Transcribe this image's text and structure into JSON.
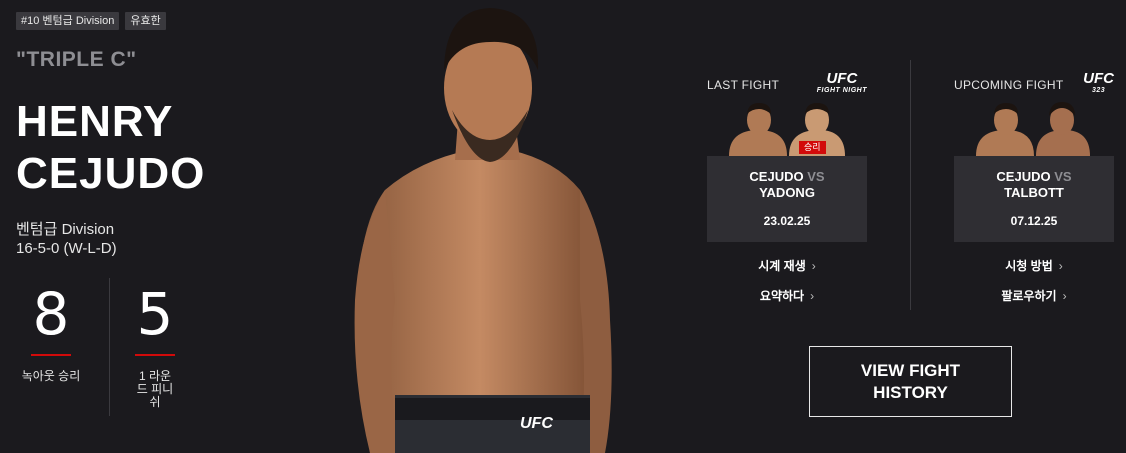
{
  "tags": [
    "#10 벤텀급 Division",
    "유효한"
  ],
  "fighter": {
    "nickname": "\"TRIPLE C\"",
    "name_line1": "HENRY",
    "name_line2": "CEJUDO",
    "division": "벤텀급 Division",
    "record": "16-5-0 (W-L-D)"
  },
  "stats": [
    {
      "value": "8",
      "label": "녹아웃 승리"
    },
    {
      "value": "5",
      "label_lines": [
        "1 라운",
        "드 피니",
        "쉬"
      ]
    }
  ],
  "last_fight": {
    "label": "LAST FIGHT",
    "logo_main": "UFC",
    "logo_sub": "FIGHT NIGHT",
    "win_badge": "승리",
    "fighter_a": "CEJUDO",
    "vs": "VS",
    "fighter_b": "YADONG",
    "date": "23.02.25",
    "links": [
      "시계 재생",
      "요약하다"
    ]
  },
  "upcoming_fight": {
    "label": "UPCOMING FIGHT",
    "logo_main": "UFC",
    "logo_sub": "323",
    "fighter_a": "CEJUDO",
    "vs": "VS",
    "fighter_b": "TALBOTT",
    "date": "07.12.25",
    "links": [
      "시청 방법",
      "팔로우하기"
    ]
  },
  "history_button": {
    "line1": "VIEW FIGHT",
    "line2": "HISTORY"
  },
  "trunks_logo": "UFC",
  "colors": {
    "background": "#1b1a1e",
    "accent": "#d20a0a",
    "card": "#2f2e33"
  }
}
